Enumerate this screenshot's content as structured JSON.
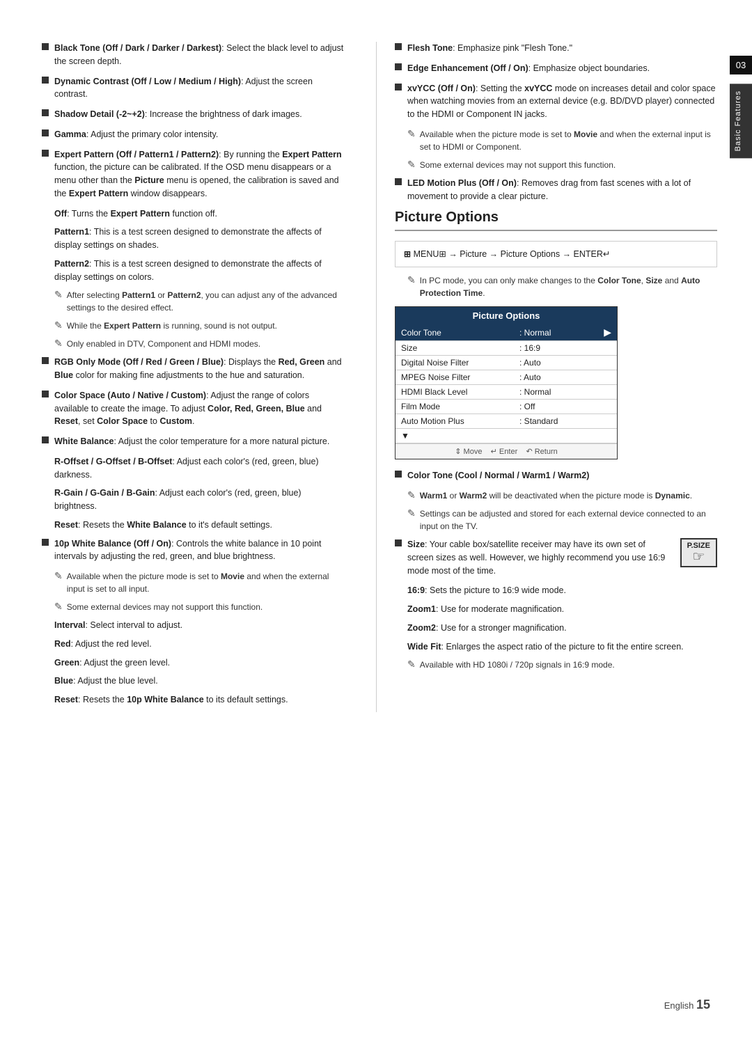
{
  "page": {
    "footer_text": "English",
    "footer_number": "15",
    "side_tab_text": "Basic Features",
    "side_tab_number": "03"
  },
  "left_column": {
    "items": [
      {
        "type": "bullet",
        "html": "<b>Black Tone (Off / Dark / Darker / Darkest)</b>: Select the black level to adjust the screen depth."
      },
      {
        "type": "bullet",
        "html": "<b>Dynamic Contrast (Off / Low / Medium / High)</b>: Adjust the screen contrast."
      },
      {
        "type": "bullet",
        "html": "<b>Shadow Detail (-2~+2)</b>: Increase the brightness of dark images."
      },
      {
        "type": "bullet",
        "html": "<b>Gamma</b>: Adjust the primary color intensity."
      },
      {
        "type": "bullet",
        "html": "<b>Expert Pattern (Off / Pattern1 / Pattern2)</b>: By running the <b>Expert Pattern</b> function, the picture can be calibrated. If the OSD menu disappears or a menu other than the <b>Picture</b> menu is opened, the calibration is saved and the <b>Expert Pattern</b> window disappears."
      }
    ],
    "sub_items": [
      {
        "type": "sub",
        "html": "<b>Off</b>: Turns the <b>Expert Pattern</b> function off."
      },
      {
        "type": "sub",
        "html": "<b>Pattern1</b>: This is a test screen designed to demonstrate the affects of display settings on shades."
      },
      {
        "type": "sub",
        "html": "<b>Pattern2</b>: This is a test screen designed to demonstrate the affects of display settings on colors."
      }
    ],
    "notes_expert": [
      "After selecting <b>Pattern1</b> or <b>Pattern2</b>, you can adjust any of the advanced settings to the desired effect.",
      "While the <b>Expert Pattern</b> is running, sound is not output.",
      "Only enabled in DTV, Component and HDMI modes."
    ],
    "items2": [
      {
        "type": "bullet",
        "html": "<b>RGB Only Mode (Off / Red / Green / Blue)</b>: Displays the <b>Red, Green</b> and <b>Blue</b> color for making fine adjustments to the hue and saturation."
      },
      {
        "type": "bullet",
        "html": "<b>Color Space (Auto / Native / Custom)</b>: Adjust the range of colors available to create the image. To adjust <b>Color, Red, Green, Blue</b> and <b>Reset</b>, set <b>Color Space</b> to <b>Custom</b>."
      },
      {
        "type": "bullet",
        "html": "<b>White Balance</b>: Adjust the color temperature for a more natural picture."
      }
    ],
    "white_balance_sub": [
      "<b>R-Offset / G-Offset / B-Offset</b>: Adjust each color's (red, green, blue) darkness.",
      "<b>R-Gain / G-Gain / B-Gain</b>: Adjust each color's (red, green, blue) brightness.",
      "<b>Reset</b>: Resets the <b>White Balance</b> to it's default settings."
    ],
    "items3": [
      {
        "type": "bullet",
        "html": "<b>10p White Balance (Off / On)</b>: Controls the white balance in 10 point intervals by adjusting the red, green, and blue brightness."
      }
    ],
    "notes_10p": [
      "Available when the picture mode is set to <b>Movie</b> and when the external input is set to all input.",
      "Some external devices may not support this function."
    ],
    "items4_sub": [
      "<b>Interval</b>: Select interval to adjust.",
      "<b>Red</b>: Adjust the red level.",
      "<b>Green</b>: Adjust the green level.",
      "<b>Blue</b>: Adjust the blue level.",
      "<b>Reset</b>: Resets the <b>10p White Balance</b> to its default settings."
    ]
  },
  "right_column": {
    "items_top": [
      {
        "type": "bullet",
        "html": "<b>Flesh Tone</b>: Emphasize pink \"Flesh Tone.\""
      },
      {
        "type": "bullet",
        "html": "<b>Edge Enhancement (Off / On)</b>: Emphasize object boundaries."
      },
      {
        "type": "bullet",
        "html": "<b>xvYCC (Off / On)</b>: Setting the <b>xvYCC</b> mode on increases detail and color space when watching movies from an external device (e.g. BD/DVD player) connected to the HDMI or Component IN jacks."
      }
    ],
    "notes_xvycc": [
      "Available when the picture mode is set to <b>Movie</b> and when the external input is set to HDMI or Component.",
      "Some external devices may not support this function."
    ],
    "items_led": [
      {
        "type": "bullet",
        "html": "<b>LED Motion Plus (Off / On)</b>: Removes drag from fast scenes with a lot of movement to provide a clear picture."
      }
    ],
    "section_heading": "Picture Options",
    "menu_path": "MENU⊞ → Picture → Picture Options → ENTER↵",
    "note_in_pc": "In PC mode, you can only make changes to the <b>Color Tone</b>, <b>Size</b> and <b>Auto Protection Time</b>.",
    "osd_table": {
      "header": "Picture Options",
      "rows": [
        {
          "left": "Color Tone",
          "right": ": Normal",
          "arrow": "►",
          "highlighted": true
        },
        {
          "left": "Size",
          "right": ": 16:9",
          "arrow": "",
          "highlighted": false
        },
        {
          "left": "Digital Noise Filter",
          "right": ": Auto",
          "arrow": "",
          "highlighted": false
        },
        {
          "left": "MPEG Noise Filter",
          "right": ": Auto",
          "arrow": "",
          "highlighted": false
        },
        {
          "left": "HDMI Black Level",
          "right": ": Normal",
          "arrow": "",
          "highlighted": false
        },
        {
          "left": "Film Mode",
          "right": ": Off",
          "arrow": "",
          "highlighted": false
        },
        {
          "left": "Auto Motion Plus",
          "right": ": Standard",
          "arrow": "",
          "highlighted": false
        },
        {
          "left": "▼",
          "right": "",
          "arrow": "",
          "highlighted": false
        }
      ],
      "footer": "⇕ Move    ↵ Enter    ↶ Return"
    },
    "bullet_color_tone": "<b>Color Tone (Cool / Normal / Warm1 / Warm2)</b>",
    "note_warm": "<b>Warm1</b> or <b>Warm2</b> will be deactivated when the picture mode is <b>Dynamic</b>.",
    "note_settings": "Settings can be adjusted and stored for each external device connected to an input on the TV.",
    "bullet_size_html": "<b>Size</b>: Your cable box/satellite receiver may have its own set of screen sizes as well. However, we highly recommend you use 16:9 mode most of the time.",
    "size_16_9": "<b>16:9</b>: Sets the picture to 16:9 wide mode.",
    "zoom1": "<b>Zoom1</b>: Use for moderate magnification.",
    "zoom2": "<b>Zoom2</b>: Use for a stronger magnification.",
    "wide_fit": "<b>Wide Fit</b>: Enlarges the aspect ratio of the picture to fit the entire screen.",
    "note_hd": "Available with HD 1080i / 720p signals in 16:9 mode.",
    "psize_label": "P.SIZE"
  }
}
